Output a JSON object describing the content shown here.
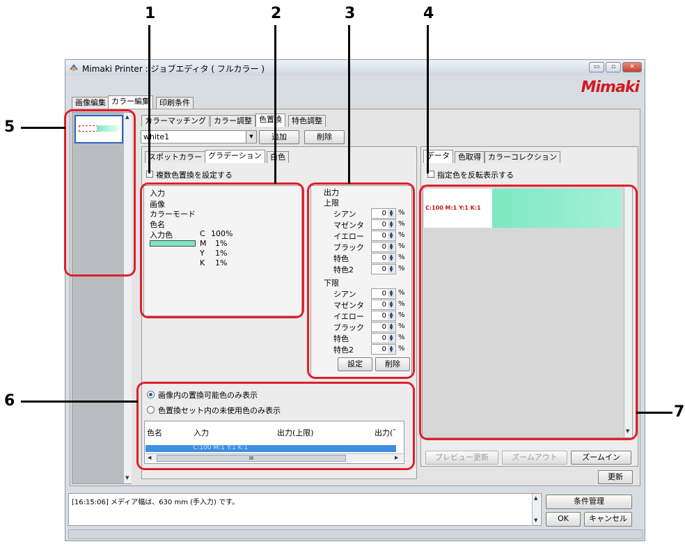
{
  "window": {
    "title": "Mimaki Printer : ジョブエディタ ( フルカラー )",
    "brand": "Mimaki",
    "controls": {
      "minimize": "▭",
      "maximize": "▫",
      "close": "✕"
    }
  },
  "callouts": [
    "1",
    "2",
    "3",
    "4",
    "5",
    "6",
    "7"
  ],
  "main_tabs": [
    "画像編集",
    "カラー編集",
    "印刷条件"
  ],
  "sub_tabs": [
    "カラーマッチング",
    "カラー調整",
    "色置換",
    "特色調整"
  ],
  "toolbar": {
    "select_value": "white1",
    "add_label": "追加",
    "delete_label": "削除"
  },
  "inner_tabs": [
    "スポットカラー",
    "グラデーション",
    "白色"
  ],
  "multi_replace_label": "複数色置換を設定する",
  "input_panel": {
    "title": "入力",
    "image_label": "画像",
    "color_mode_label": "カラーモード",
    "color_name_label": "色名",
    "input_color_label": "入力色",
    "swatch_color": "#7ce8c2",
    "values": [
      {
        "ch": "C",
        "val": "100%"
      },
      {
        "ch": "M",
        "val": "1%"
      },
      {
        "ch": "Y",
        "val": "1%"
      },
      {
        "ch": "K",
        "val": "1%"
      }
    ]
  },
  "output_panel": {
    "title": "出力",
    "upper_label": "上限",
    "lower_label": "下限",
    "upper": [
      {
        "label": "シアン",
        "value": "0"
      },
      {
        "label": "マゼンタ",
        "value": "0"
      },
      {
        "label": "イエロー",
        "value": "0"
      },
      {
        "label": "ブラック",
        "value": "0"
      },
      {
        "label": "特色",
        "value": "0"
      },
      {
        "label": "特色2",
        "value": "0"
      }
    ],
    "lower": [
      {
        "label": "シアン",
        "value": "0"
      },
      {
        "label": "マゼンタ",
        "value": "0"
      },
      {
        "label": "イエロー",
        "value": "0"
      },
      {
        "label": "ブラック",
        "value": "0"
      },
      {
        "label": "特色",
        "value": "0"
      },
      {
        "label": "特色2",
        "value": "0"
      }
    ],
    "unit": "%",
    "set_label": "設定",
    "delete_label": "削除"
  },
  "list_panel": {
    "radio1": "画像内の置換可能色のみ表示",
    "radio2": "色置換セット内の未使用色のみ表示",
    "columns": [
      "色名",
      "入力",
      "出力(上限)",
      "出力(下限)"
    ],
    "rows": [
      {
        "name": "",
        "input": "C:100 M:1 Y:1 K:1",
        "out_upper": "",
        "out_lower": ""
      }
    ],
    "scroll_grip": "III"
  },
  "right_tabs": [
    "データ",
    "色取得",
    "カラーコレクション"
  ],
  "invert_label": "指定色を反転表示する",
  "preview": {
    "label": "C:100  M:1  Y:1  K:1",
    "swatch_color": "#7ce8c2"
  },
  "preview_buttons": {
    "update": "プレビュー更新",
    "zoom_out": "ズームアウト",
    "zoom_in": "ズームイン"
  },
  "refresh_label": "更新",
  "log_text": "[16:15:06] メディア幅は、630 mm (手入力) です。",
  "bottom_buttons": {
    "condition": "条件管理",
    "ok": "OK",
    "cancel": "キャンセル"
  },
  "colors": {
    "callout_box": "#e0202a",
    "brand": "#d21920",
    "selection": "#3d8fe0",
    "swatch": "#7ce8c2"
  }
}
